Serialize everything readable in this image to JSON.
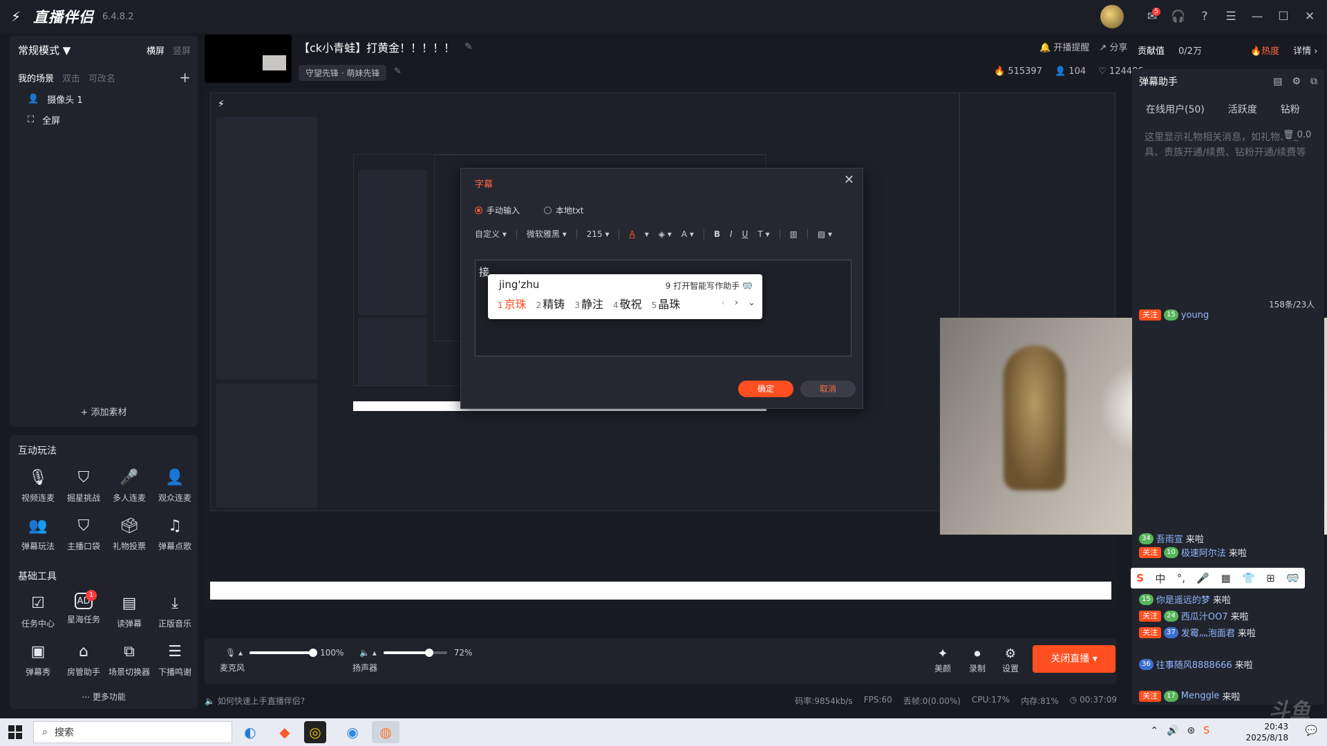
{
  "app": {
    "name": "直播伴侣",
    "version": "6.4.8.2",
    "notification_count": "5"
  },
  "scene_panel": {
    "mode": "常规模式",
    "landscape": "横屏",
    "portrait": "竖屏",
    "my_scenes": "我的场景",
    "double_click": "双击",
    "rename": "可改名",
    "sources": [
      {
        "label": "摄像头 1",
        "icon": "camera-icon"
      },
      {
        "label": "全屏",
        "icon": "fullscreen-icon"
      }
    ],
    "add_material": "添加素材"
  },
  "interactive": {
    "title": "互动玩法",
    "items": [
      {
        "label": "视频连麦",
        "icon": "mic-icon",
        "glyph": "🎙"
      },
      {
        "label": "掘星挑战",
        "icon": "shield-icon",
        "glyph": "⛉"
      },
      {
        "label": "多人连麦",
        "icon": "multi-mic-icon",
        "glyph": "🎤"
      },
      {
        "label": "观众连麦",
        "icon": "user-add-icon",
        "glyph": "👤"
      },
      {
        "label": "弹幕玩法",
        "icon": "danmu-game-icon",
        "glyph": "👥"
      },
      {
        "label": "主播口袋",
        "icon": "pocket-icon",
        "glyph": "⛉"
      },
      {
        "label": "礼物投票",
        "icon": "vote-icon",
        "glyph": "🗳"
      },
      {
        "label": "弹幕点歌",
        "icon": "song-icon",
        "glyph": "♫"
      }
    ]
  },
  "basic_tools": {
    "title": "基础工具",
    "items": [
      {
        "label": "任务中心",
        "icon": "task-icon",
        "glyph": "☑",
        "badge": ""
      },
      {
        "label": "星海任务",
        "icon": "ad-icon",
        "glyph": "AD",
        "badge": "1"
      },
      {
        "label": "读弹幕",
        "icon": "read-danmu-icon",
        "glyph": "▤",
        "badge": ""
      },
      {
        "label": "正版音乐",
        "icon": "download-music-icon",
        "glyph": "⤓",
        "badge": ""
      },
      {
        "label": "弹幕秀",
        "icon": "danmu-show-icon",
        "glyph": "▣",
        "badge": ""
      },
      {
        "label": "房管助手",
        "icon": "room-admin-icon",
        "glyph": "⌂",
        "badge": ""
      },
      {
        "label": "场景切换器",
        "icon": "scene-switch-icon",
        "glyph": "⧉",
        "badge": ""
      },
      {
        "label": "下播鸣谢",
        "icon": "thanks-icon",
        "glyph": "☰",
        "badge": ""
      }
    ],
    "more": "更多功能"
  },
  "stream": {
    "title": "【ck小青蛙】打黄金！！！！！",
    "category": "守望先锋 · 萌妹先锋",
    "notify": "开播提醒",
    "share": "分享",
    "popularity": "515397",
    "viewers": "104",
    "likes": "124486"
  },
  "dialog": {
    "title": "字幕",
    "manual": "手动输入",
    "local_txt": "本地txt",
    "preset": "自定义",
    "font": "微软雅黑",
    "size": "215",
    "typed": "接",
    "ok": "确定",
    "cancel": "取消"
  },
  "ime": {
    "pinyin": "jing'zhu",
    "assist_num": "9",
    "assist": "打开智能写作助手",
    "candidates": [
      {
        "n": "1",
        "t": "京珠"
      },
      {
        "n": "2",
        "t": "精铸"
      },
      {
        "n": "3",
        "t": "静注"
      },
      {
        "n": "4",
        "t": "敬祝"
      },
      {
        "n": "5",
        "t": "晶珠"
      }
    ]
  },
  "bottom": {
    "mic_label": "麦克风",
    "mic_value": "100%",
    "mic_level": 1.0,
    "speaker_label": "扬声器",
    "speaker_value": "72%",
    "speaker_level": 0.72,
    "beauty": "美颜",
    "record": "录制",
    "settings": "设置",
    "stop_live": "关闭直播",
    "help": "如何快速上手直播伴侣?",
    "bitrate": "码率:9854kb/s",
    "fps": "FPS:60",
    "dropped": "丢帧:0(0.00%)",
    "cpu": "CPU:17%",
    "memory": "内存:81%",
    "duration": "00:37:09"
  },
  "right_panel": {
    "contribution": "贡献值",
    "contribution_value": "0/2万",
    "hot": "热度",
    "detail": "详情",
    "danmu_assistant": "弹幕助手",
    "tabs": [
      "在线用户(50)",
      "活跃度",
      "钻粉"
    ],
    "gift_tip": "这里显示礼物相关消息，如礼物、道具、贵族开通/续费、钻粉开通/续费等",
    "gift_counter": "0.0",
    "danmu_count": "158条/23人",
    "chat": [
      {
        "follow": "关注",
        "lv": "15",
        "name": "young"
      },
      {
        "follow": "",
        "lv": "34",
        "name": "吾雨宣",
        "msg": "来啦"
      },
      {
        "follow": "关注",
        "lv": "10",
        "name": "极速阿尔法",
        "msg": "来啦"
      },
      {
        "follow": "",
        "lv": "15",
        "name": "你是遥远的梦",
        "msg": "来啦"
      },
      {
        "follow": "关注",
        "lv": "24",
        "name": "西瓜汁OO7",
        "msg": "来啦"
      },
      {
        "follow": "关注",
        "lv": "37",
        "name": "发霉灬泡面君",
        "msg": "来啦"
      },
      {
        "follow": "",
        "lv": "36",
        "name": "往事随风8888666",
        "msg": "来啦"
      },
      {
        "follow": "关注",
        "lv": "17",
        "name": "Menggle",
        "msg": "来啦"
      }
    ]
  },
  "ime_bar": [
    "S",
    "中",
    "°,",
    "🎤",
    "▦",
    "👕",
    "⊞",
    "🥽"
  ],
  "taskbar": {
    "search": "搜索",
    "time": "20:43",
    "date": "2025/8/18",
    "lang": "中"
  },
  "watermark": "斗鱼"
}
